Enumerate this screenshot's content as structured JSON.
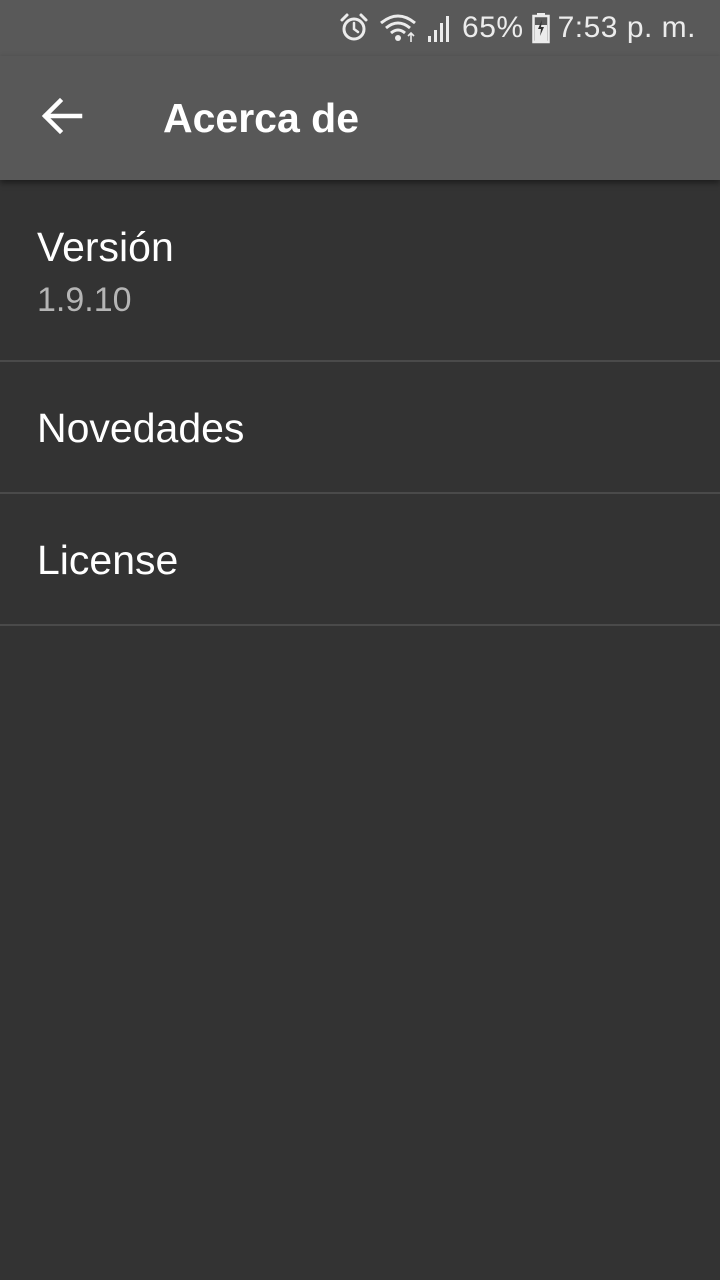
{
  "status_bar": {
    "icons": [
      "alarm-icon",
      "wifi-icon",
      "signal-icon",
      "battery-charging-icon"
    ],
    "battery": "65%",
    "time": "7:53 p. m."
  },
  "app_bar": {
    "back_icon": "arrow-back-icon",
    "title": "Acerca de"
  },
  "items": [
    {
      "title": "Versión",
      "summary": "1.9.10"
    },
    {
      "title": "Novedades"
    },
    {
      "title": "License"
    }
  ],
  "colors": {
    "background": "#333333",
    "app_bar": "#585858",
    "status_bar": "#595959",
    "divider": "#4a4a4a",
    "summary_text": "#b5b5b5"
  }
}
